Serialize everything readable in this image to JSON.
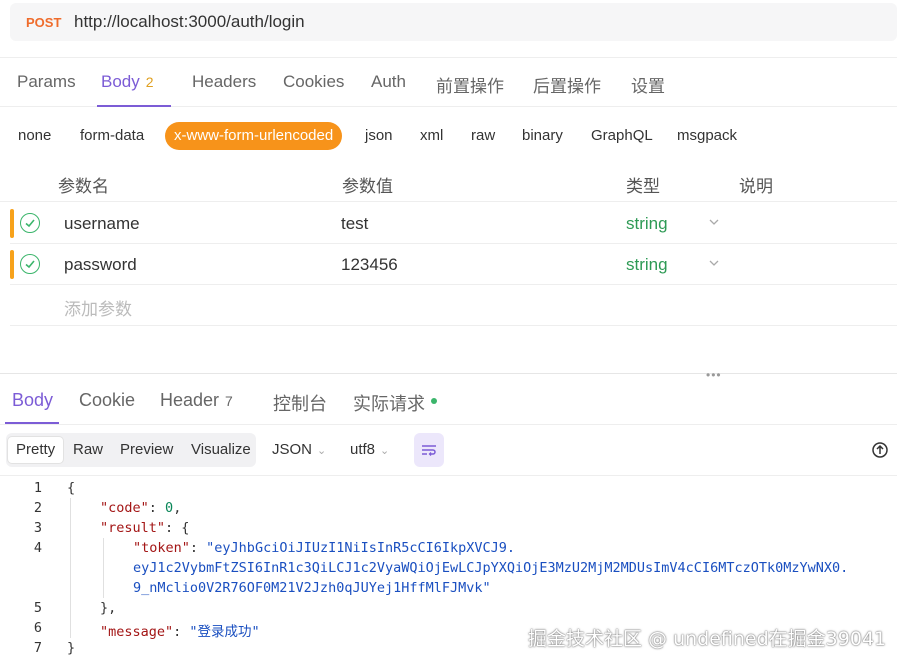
{
  "request": {
    "method": "POST",
    "url": "http://localhost:3000/auth/login"
  },
  "request_tabs": [
    {
      "label": "Params"
    },
    {
      "label": "Body",
      "badge": "2"
    },
    {
      "label": "Headers"
    },
    {
      "label": "Cookies"
    },
    {
      "label": "Auth"
    },
    {
      "label": "前置操作"
    },
    {
      "label": "后置操作"
    },
    {
      "label": "设置"
    }
  ],
  "body_types": [
    "none",
    "form-data",
    "x-www-form-urlencoded",
    "json",
    "xml",
    "raw",
    "binary",
    "GraphQL",
    "msgpack"
  ],
  "params_header": {
    "name": "参数名",
    "value": "参数值",
    "type": "类型",
    "desc": "说明"
  },
  "params": [
    {
      "name": "username",
      "value": "test",
      "type": "string"
    },
    {
      "name": "password",
      "value": "123456",
      "type": "string"
    }
  ],
  "add_param_placeholder": "添加参数",
  "response_tabs": [
    {
      "label": "Body"
    },
    {
      "label": "Cookie"
    },
    {
      "label": "Header",
      "badge": "7"
    },
    {
      "label": "控制台"
    },
    {
      "label": "实际请求"
    }
  ],
  "view_modes": [
    "Pretty",
    "Raw",
    "Preview",
    "Visualize"
  ],
  "format_select": "JSON",
  "encoding_select": "utf8",
  "code_lines": {
    "n1": "1",
    "n2": "2",
    "n3": "3",
    "n4": "4",
    "n5": "5",
    "n6": "6",
    "n7": "7",
    "open_brace": "{",
    "code_key": "\"code\"",
    "code_val": "0",
    "result_key": "\"result\"",
    "token_key": "\"token\"",
    "token_val_1": "\"eyJhbGciOiJIUzI1NiIsInR5cCI6IkpXVCJ9.",
    "token_val_2": "eyJ1c2VybmFtZSI6InR1c3QiLCJ1c2VyaWQiOjEwLCJpYXQiOjE3MzU2MjM2MDUsImV4cCI6MTczOTk0MzYwNX0.",
    "token_val_3": "9_nMclio0V2R76OF0M21V2Jzh0qJUYej1HffMlFJMvk\"",
    "close_result": "},",
    "message_key": "\"message\"",
    "message_val": "\"登录成功\"",
    "close_brace": "}"
  },
  "watermark": "掘金技术社区 @ undefined在掘金39041",
  "colors": {
    "accent": "#7c5cd6",
    "method": "#ef6c2c",
    "active_body_type": "#f7931a",
    "type_green": "#2e9a55"
  }
}
